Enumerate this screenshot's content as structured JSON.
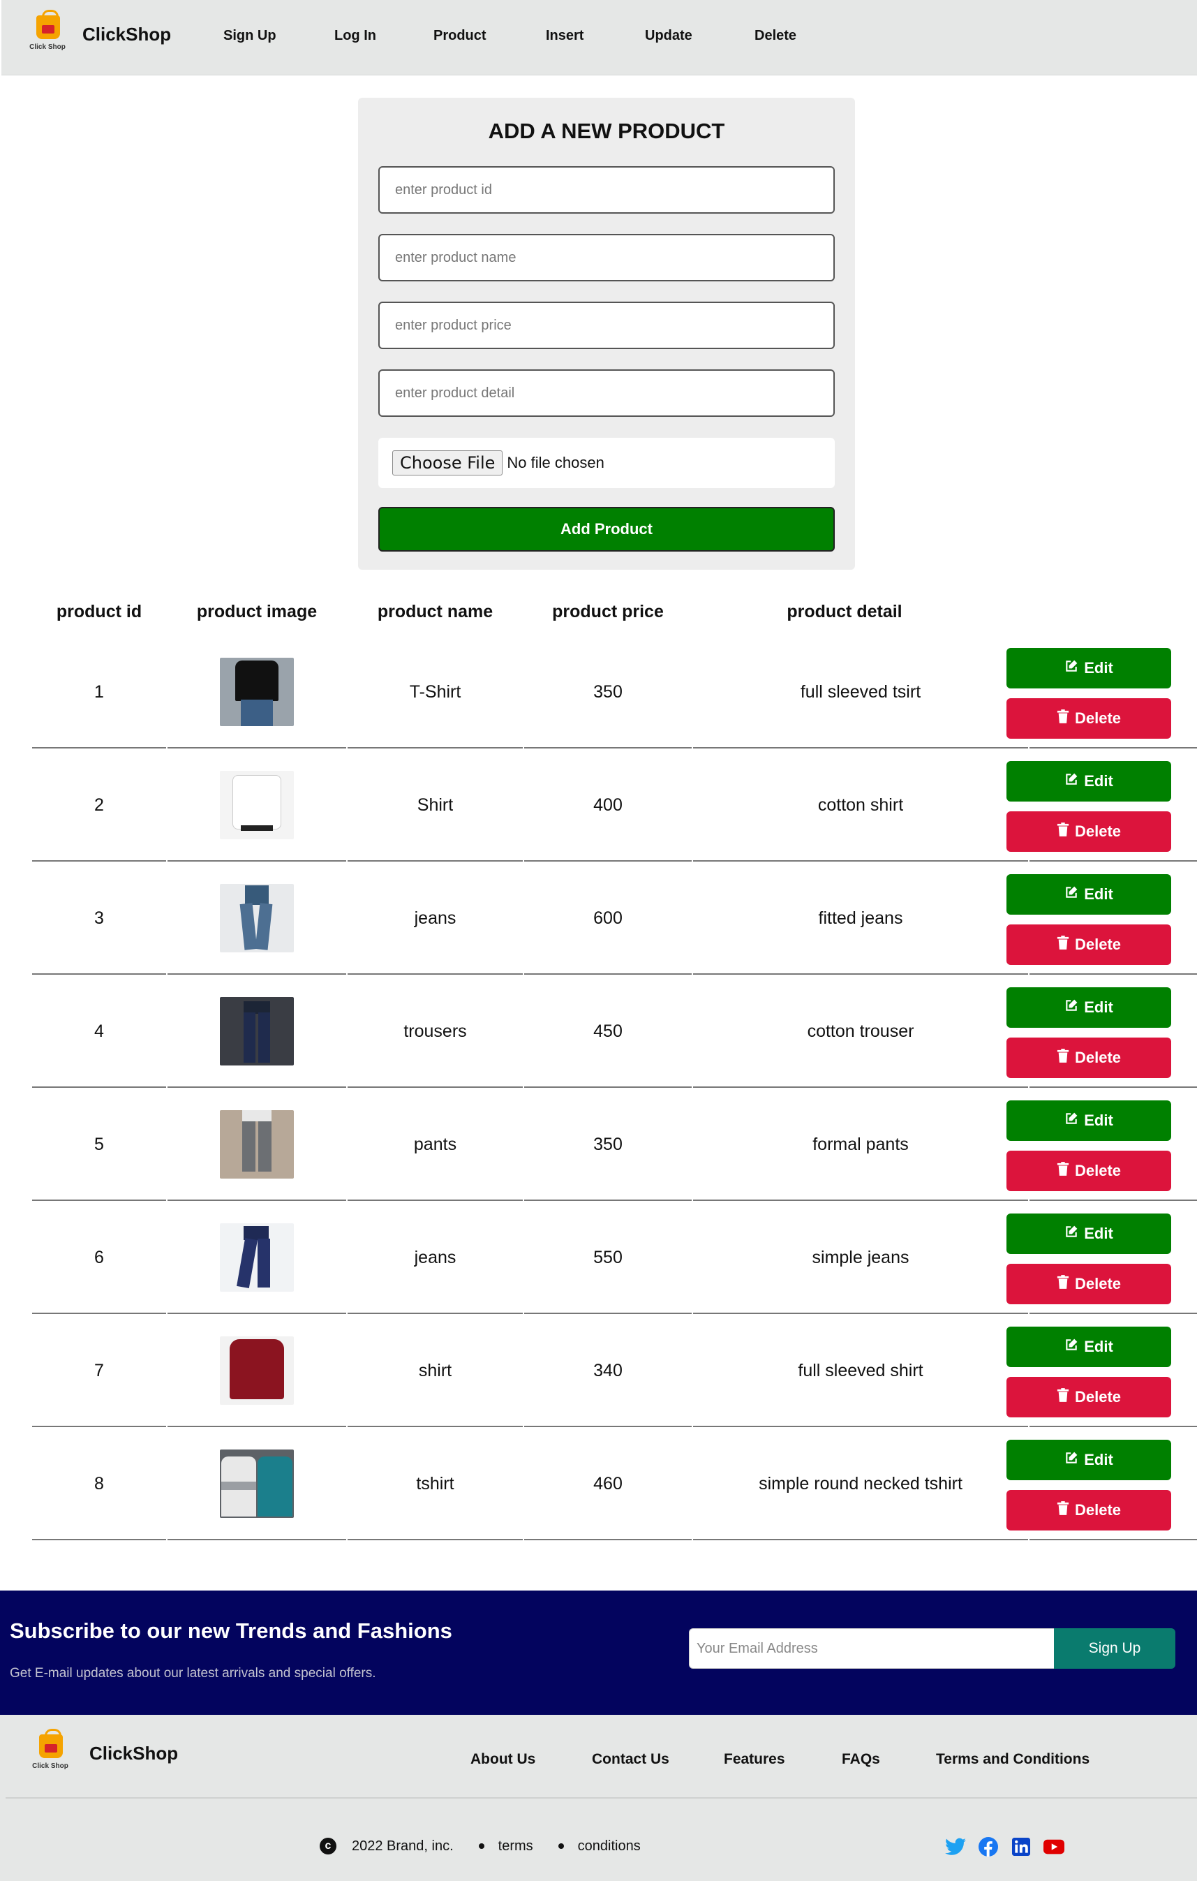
{
  "nav": {
    "brand": "ClickShop",
    "logo_caption": "Click Shop",
    "links": [
      "Sign Up",
      "Log In",
      "Product",
      "Insert",
      "Update",
      "Delete"
    ]
  },
  "form": {
    "title": "ADD A NEW PRODUCT",
    "placeholders": {
      "id": "enter product id",
      "name": "enter product name",
      "price": "enter product price",
      "detail": "enter product detail"
    },
    "file_button": "Choose File",
    "file_status": "No file chosen",
    "submit": "Add Product"
  },
  "table": {
    "headers": [
      "product id",
      "product image",
      "product name",
      "product price",
      "product detail"
    ],
    "edit_label": "Edit",
    "delete_label": "Delete",
    "rows": [
      {
        "id": "1",
        "name": "T-Shirt",
        "price": "350",
        "detail": "full sleeved tsirt"
      },
      {
        "id": "2",
        "name": "Shirt",
        "price": "400",
        "detail": "cotton shirt"
      },
      {
        "id": "3",
        "name": "jeans",
        "price": "600",
        "detail": "fitted jeans"
      },
      {
        "id": "4",
        "name": "trousers",
        "price": "450",
        "detail": "cotton trouser"
      },
      {
        "id": "5",
        "name": "pants",
        "price": "350",
        "detail": "formal pants"
      },
      {
        "id": "6",
        "name": "jeans",
        "price": "550",
        "detail": "simple jeans"
      },
      {
        "id": "7",
        "name": "shirt",
        "price": "340",
        "detail": "full sleeved shirt"
      },
      {
        "id": "8",
        "name": "tshirt",
        "price": "460",
        "detail": "simple round necked tshirt"
      }
    ]
  },
  "subscribe": {
    "title": "Subscribe to our new Trends and Fashions",
    "text": "Get E-mail updates about our latest arrivals and special offers.",
    "placeholder": "Your Email Address",
    "button": "Sign Up"
  },
  "footer": {
    "brand": "ClickShop",
    "logo_caption": "Click Shop",
    "links": [
      "About Us",
      "Contact Us",
      "Features",
      "FAQs",
      "Terms and Conditions"
    ],
    "copyright": "2022 Brand, inc.",
    "terms": "terms",
    "conditions": "conditions",
    "socials": [
      "twitter-icon",
      "facebook-icon",
      "linkedin-icon",
      "youtube-icon"
    ]
  },
  "colors": {
    "edit": "#008000",
    "delete": "#dc143c",
    "subscribe_bg": "#03045e",
    "signup_btn": "#0a7b6e"
  }
}
